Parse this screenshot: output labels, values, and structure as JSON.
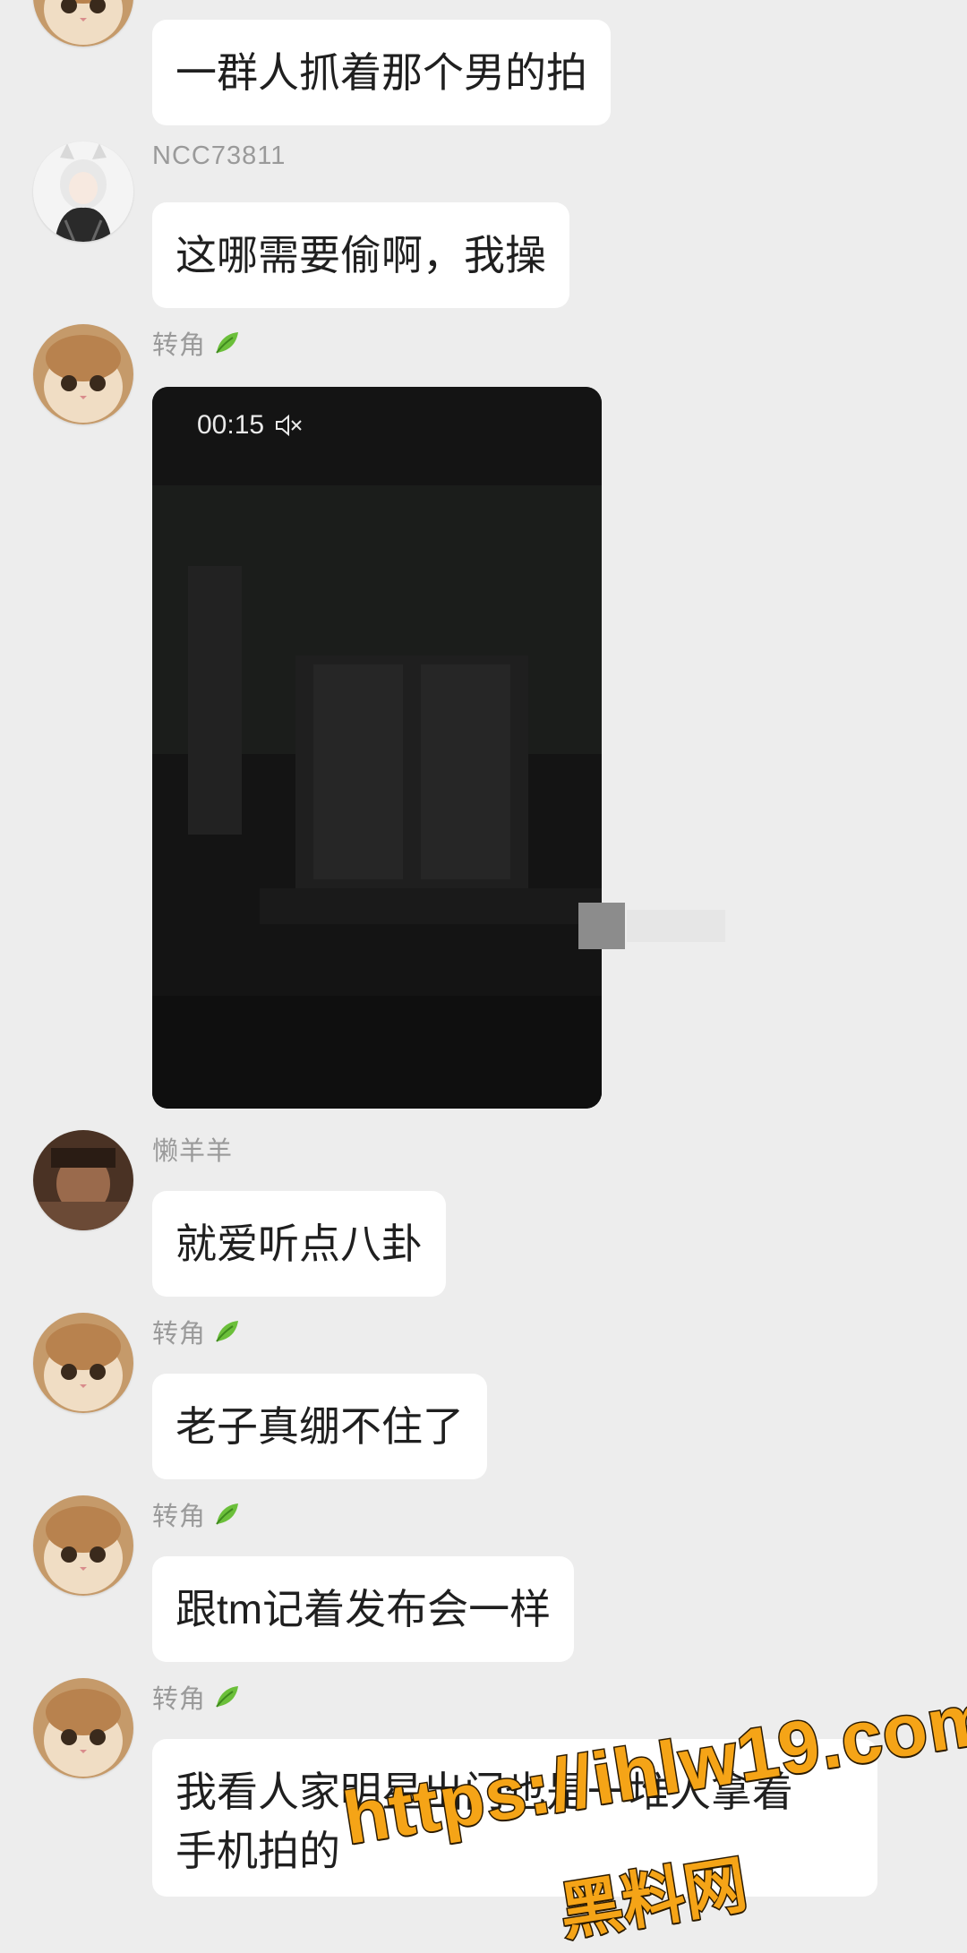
{
  "messages": [
    {
      "type": "text",
      "sender": "",
      "avatar": "cat-avatar",
      "text": "一群人抓着那个男的拍"
    },
    {
      "type": "text",
      "sender": "NCC73811",
      "avatar": "anime-girl-avatar",
      "text": "这哪需要偷啊，我操"
    },
    {
      "type": "video",
      "sender": "转角",
      "badge": "leaf-icon",
      "avatar": "cat-avatar",
      "duration": "00:15",
      "muted_icon": "speaker-mute-icon"
    },
    {
      "type": "text",
      "sender": "懒羊羊",
      "avatar": "photo-avatar",
      "text": "就爱听点八卦"
    },
    {
      "type": "text",
      "sender": "转角",
      "badge": "leaf-icon",
      "avatar": "cat-avatar",
      "text": "老子真绷不住了"
    },
    {
      "type": "text",
      "sender": "转角",
      "badge": "leaf-icon",
      "avatar": "cat-avatar",
      "text": "跟tm记着发布会一样"
    },
    {
      "type": "text",
      "sender": "转角",
      "badge": "leaf-icon",
      "avatar": "cat-avatar",
      "text_line1": "我看人家明星出门也是一堆人拿着",
      "text_line2": "手机拍的"
    }
  ],
  "watermark": {
    "url": "https://ihlw19.com",
    "brand": "黑料网"
  },
  "colors": {
    "background": "#ededed",
    "bubble": "#ffffff",
    "sender": "#9a9a9a",
    "watermark": "#f5a417"
  }
}
